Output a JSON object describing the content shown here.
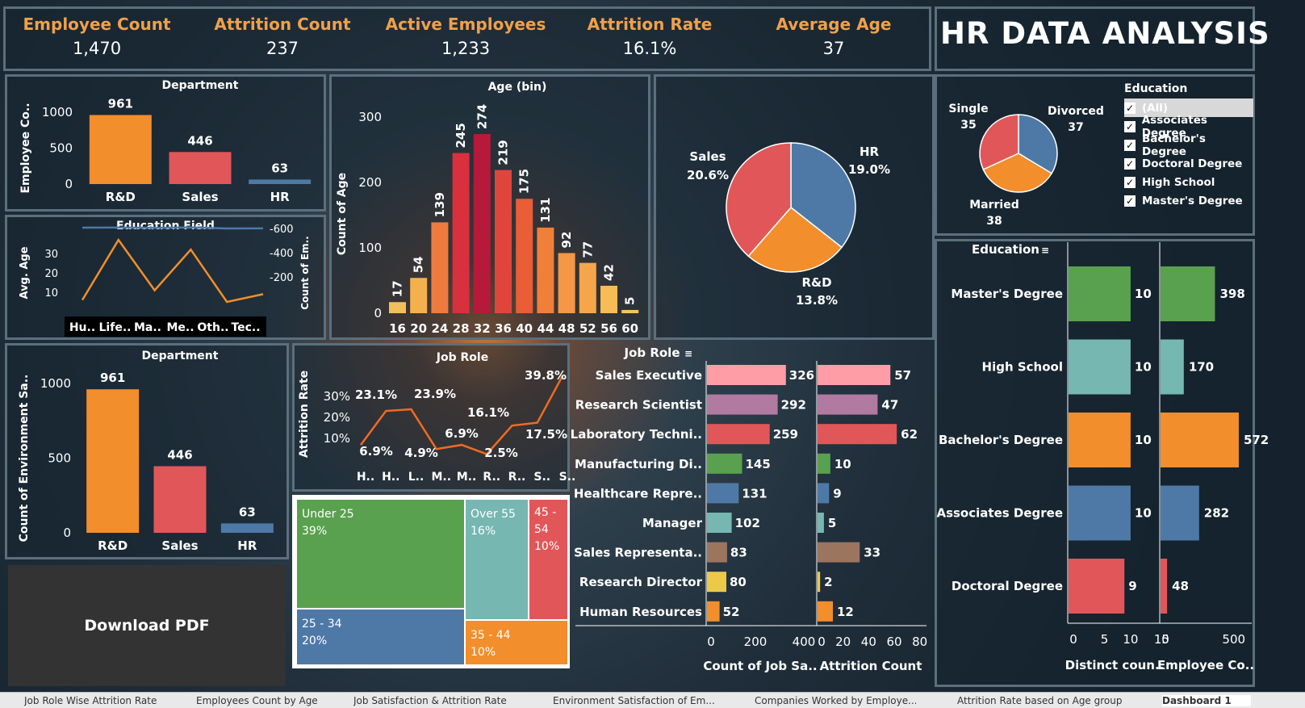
{
  "title": "HR DATA ANALYSIS",
  "kpis": [
    {
      "label": "Employee Count",
      "value": "1,470"
    },
    {
      "label": "Attrition Count",
      "value": "237"
    },
    {
      "label": "Active Employees",
      "value": "1,233"
    },
    {
      "label": "Attrition Rate",
      "value": "16.1%"
    },
    {
      "label": "Average Age",
      "value": "37"
    }
  ],
  "colors": {
    "orange": "#f28e2b",
    "red": "#e15759",
    "blue": "#4e79a7",
    "teal": "#76b7b2",
    "green": "#59a14f",
    "kpi": "#f0a04b"
  },
  "download_label": "Download PDF",
  "education_filter": {
    "header": "Education",
    "options": [
      "(All)",
      "Associates Degree",
      "Bachelor's Degree",
      "Doctoral Degree",
      "High School",
      "Master's Degree"
    ]
  },
  "tabs": [
    "Job Role Wise Attrition Rate",
    "Employees Count by Age",
    "Job Satisfaction & Attrition Rate",
    "Environment Satisfaction of Em...",
    "Companies Worked by Employe...",
    "Attrition Rate based on Age group",
    "Dashboard 1"
  ],
  "chart_data": [
    {
      "id": "dept1",
      "type": "bar",
      "title": "Department",
      "ylabel": "Employee Co..",
      "categories": [
        "R&D",
        "Sales",
        "HR"
      ],
      "values": [
        961,
        446,
        63
      ],
      "yticks": [
        0,
        500,
        1000
      ],
      "ylim": [
        0,
        1000
      ]
    },
    {
      "id": "edufield",
      "type": "line",
      "title": "Education Field",
      "ylabel": "Avg. Age",
      "y2label": "Count of Em..",
      "categories": [
        "Hu..",
        "Life..",
        "Ma..",
        "Me..",
        "Oth..",
        "Tec.."
      ],
      "series": [
        {
          "values": [
            6,
            37,
            11,
            32,
            5,
            9
          ],
          "axis": "left"
        },
        {
          "values": [
            640,
            641,
            638,
            642,
            633,
            634
          ],
          "axis": "right"
        }
      ],
      "yticks": [
        10,
        20,
        30
      ],
      "y2ticks": [
        200,
        400,
        600
      ]
    },
    {
      "id": "age",
      "type": "bar",
      "title": "Age (bin)",
      "ylabel": "Count of Age",
      "categories": [
        "16",
        "20",
        "24",
        "28",
        "32",
        "36",
        "40",
        "44",
        "48",
        "52",
        "56",
        "60"
      ],
      "values": [
        17,
        54,
        139,
        245,
        274,
        219,
        175,
        131,
        92,
        77,
        42,
        5
      ],
      "yticks": [
        0,
        100,
        200,
        300
      ],
      "ylim": [
        0,
        300
      ]
    },
    {
      "id": "pie1",
      "type": "pie",
      "labels": [
        "HR",
        "R&D",
        "Sales"
      ],
      "values": [
        19.0,
        13.8,
        20.6
      ],
      "value_labels": [
        "19.0%",
        "13.8%",
        "20.6%"
      ]
    },
    {
      "id": "pie2",
      "type": "pie",
      "labels": [
        "Divorced",
        "Married",
        "Single"
      ],
      "values": [
        37,
        38,
        35
      ]
    },
    {
      "id": "dept2",
      "type": "bar",
      "title": "Department",
      "ylabel": "Count of Environment Sa..",
      "categories": [
        "R&D",
        "Sales",
        "HR"
      ],
      "values": [
        961,
        446,
        63
      ],
      "yticks": [
        0,
        500,
        1000
      ],
      "ylim": [
        0,
        1000
      ]
    },
    {
      "id": "jobrole",
      "type": "line",
      "title": "Job Role",
      "ylabel": "Attrition Rate",
      "categories": [
        "H..",
        "H..",
        "L..",
        "M..",
        "M..",
        "R..",
        "R..",
        "S..",
        "S.."
      ],
      "values": [
        6.9,
        23.1,
        23.9,
        4.9,
        6.9,
        2.5,
        16.1,
        17.5,
        39.8
      ],
      "value_labels": [
        "6.9%",
        "23.1%",
        "23.9%",
        "4.9%",
        "6.9%",
        "2.5%",
        "16.1%",
        "17.5%",
        "39.8%"
      ],
      "yticks": [
        "10%",
        "20%",
        "30%"
      ]
    },
    {
      "id": "treemap",
      "type": "treemap",
      "labels": [
        "Under 25",
        "Over 55",
        "45 - 54",
        "25 - 34",
        "35 - 44"
      ],
      "values": [
        39,
        16,
        10,
        20,
        10
      ],
      "value_labels": [
        "39%",
        "16%",
        "10%",
        "20%",
        "10%"
      ]
    },
    {
      "id": "jobrole_bars",
      "type": "bar",
      "header": "Job Role",
      "categories": [
        "Sales Executive",
        "Research Scientist",
        "Laboratory Techni..",
        "Manufacturing Di..",
        "Healthcare Repre..",
        "Manager",
        "Sales Representa..",
        "Research Director",
        "Human Resources"
      ],
      "series": [
        {
          "name": "Count of Job Sa..",
          "values": [
            326,
            292,
            259,
            145,
            131,
            102,
            83,
            80,
            52
          ],
          "xticks": [
            0,
            200,
            400
          ]
        },
        {
          "name": "Attrition Count",
          "values": [
            57,
            47,
            62,
            10,
            9,
            5,
            33,
            2,
            12
          ],
          "xticks": [
            0,
            20,
            40,
            60,
            80
          ]
        }
      ]
    },
    {
      "id": "education_bars",
      "type": "bar",
      "header": "Education",
      "categories": [
        "Master's Degree",
        "High School",
        "Bachelor's Degree",
        "Associates Degree",
        "Doctoral Degree"
      ],
      "series": [
        {
          "name": "Distinct coun..",
          "values": [
            10,
            10,
            10,
            10,
            9
          ],
          "xticks": [
            0,
            5,
            10,
            15
          ]
        },
        {
          "name": "Employee Co..",
          "values": [
            398,
            170,
            572,
            282,
            48
          ],
          "xticks": [
            0,
            500
          ]
        }
      ]
    }
  ]
}
